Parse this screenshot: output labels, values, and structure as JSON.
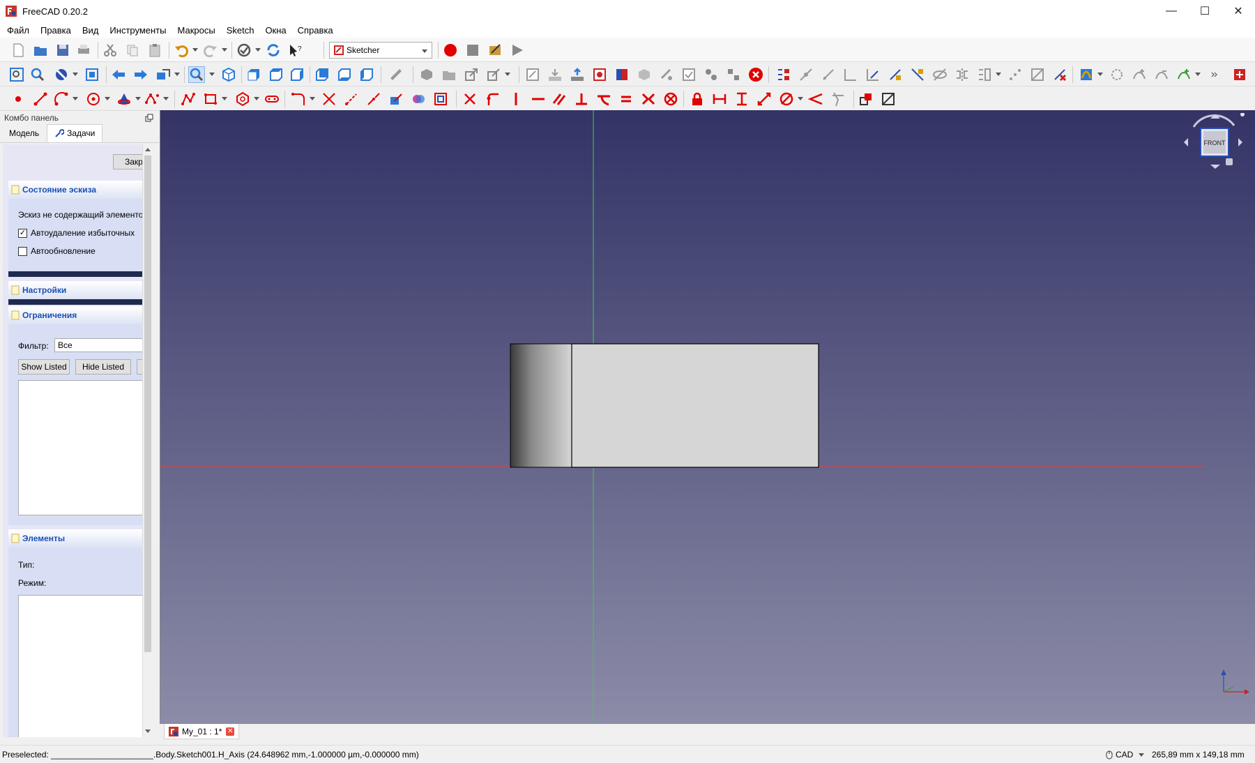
{
  "window": {
    "title": "FreeCAD 0.20.2",
    "minimize": "—",
    "maximize": "☐",
    "close": "✕"
  },
  "menu": [
    "Файл",
    "Правка",
    "Вид",
    "Инструменты",
    "Макросы",
    "Sketch",
    "Окна",
    "Справка"
  ],
  "toolbar": {
    "workbench": "Sketcher"
  },
  "combo": {
    "title": "Комбо панель",
    "tabs": [
      "Модель",
      "Задачи"
    ],
    "close_button": "Закр",
    "sections": {
      "sketch_state": {
        "title": "Состояние эскиза",
        "message": "Эскиз не содержащий элементов",
        "auto_remove": {
          "label": "Автоудаление избыточных",
          "checked": true
        },
        "auto_update": {
          "label": "Автообновление",
          "checked": false
        }
      },
      "settings": {
        "title": "Настройки"
      },
      "constraints": {
        "title": "Ограничения",
        "filter_label": "Фильтр:",
        "filter_value": "Все",
        "show_listed": "Show Listed",
        "hide_listed": "Hide Listed"
      },
      "elements": {
        "title": "Элементы",
        "type_label": "Тип:",
        "mode_label": "Режим:"
      }
    }
  },
  "navcube": {
    "face": "FRONT"
  },
  "document_tab": {
    "label": "My_01 : 1*"
  },
  "status": {
    "message": "Preselected: ______________________.Body.Sketch001.H_Axis (24.648962 mm,-1.000000 µm,-0.000000 mm)",
    "nav_style": "CAD",
    "dimensions": "265,89 mm x 149,18 mm"
  },
  "colors": {
    "h_axis": "#e04040",
    "v_axis": "#40d040",
    "part_face": "#d6d6d6",
    "accent_red": "#e00000"
  }
}
